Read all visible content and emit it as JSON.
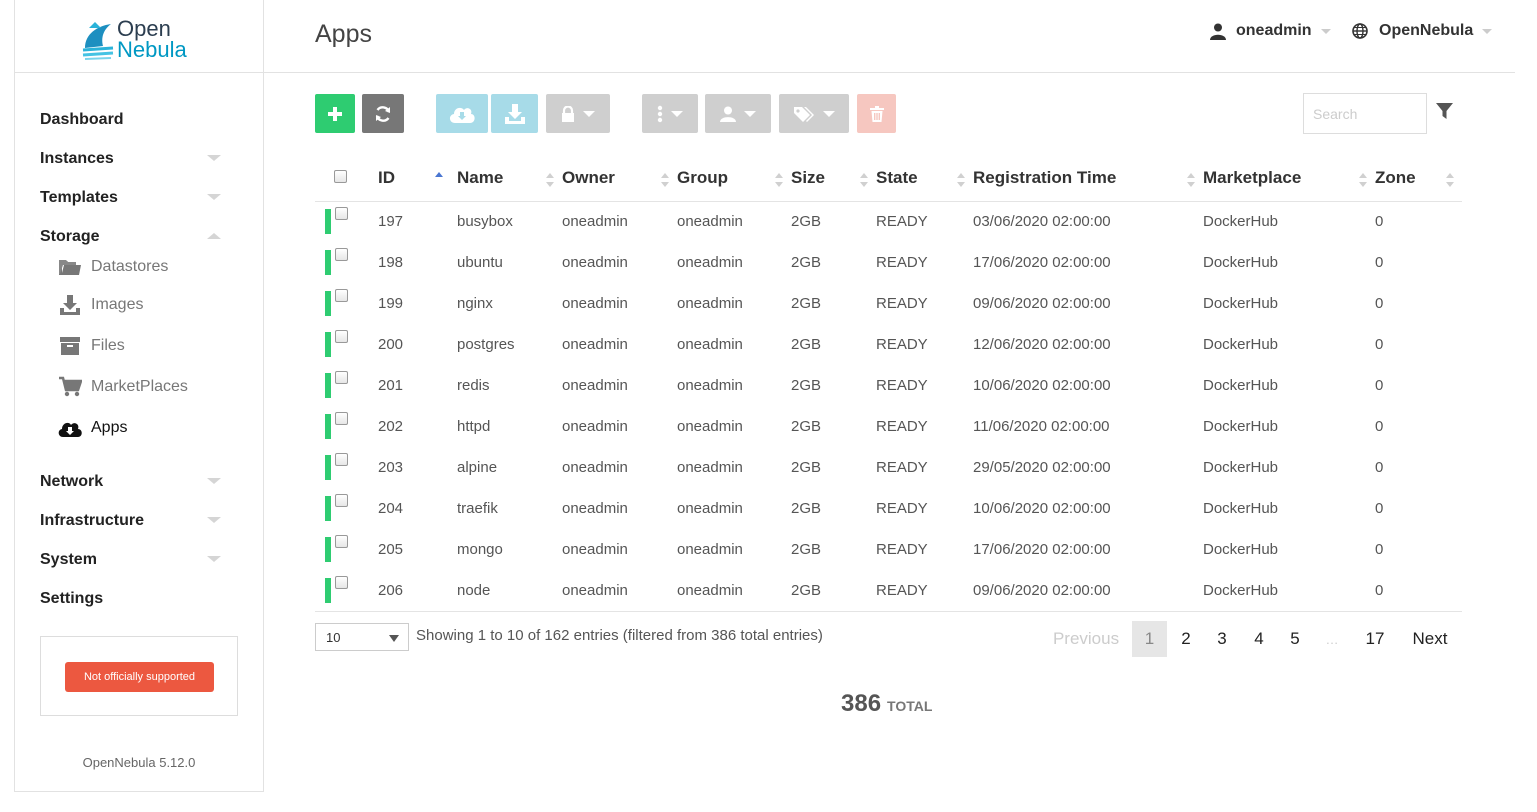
{
  "brand": {
    "line1": "Open",
    "line2": "Nebula"
  },
  "sidebar": {
    "items": [
      {
        "label": "Dashboard"
      },
      {
        "label": "Instances"
      },
      {
        "label": "Templates"
      },
      {
        "label": "Storage"
      },
      {
        "label": "Network"
      },
      {
        "label": "Infrastructure"
      },
      {
        "label": "System"
      },
      {
        "label": "Settings"
      }
    ],
    "storage_sub": [
      {
        "label": "Datastores",
        "icon": "folder-icon"
      },
      {
        "label": "Images",
        "icon": "download-icon"
      },
      {
        "label": "Files",
        "icon": "archive-icon"
      },
      {
        "label": "MarketPlaces",
        "icon": "cart-icon"
      },
      {
        "label": "Apps",
        "icon": "cloud-download-icon"
      }
    ],
    "support_badge": "Not officially supported",
    "version": "OpenNebula 5.12.0"
  },
  "header": {
    "title": "Apps",
    "user": "oneadmin",
    "zone": "OpenNebula"
  },
  "toolbar": {
    "search_placeholder": "Search",
    "colors": {
      "green": "#2ecc71",
      "gray": "#777777",
      "lightblue": "#a7dbe8",
      "lightgray": "#cfcfcf",
      "lightred": "#f6c7c0"
    }
  },
  "table": {
    "columns": [
      "ID",
      "Name",
      "Owner",
      "Group",
      "Size",
      "State",
      "Registration Time",
      "Marketplace",
      "Zone"
    ],
    "rows": [
      [
        "197",
        "busybox",
        "oneadmin",
        "oneadmin",
        "2GB",
        "READY",
        "03/06/2020 02:00:00",
        "DockerHub",
        "0"
      ],
      [
        "198",
        "ubuntu",
        "oneadmin",
        "oneadmin",
        "2GB",
        "READY",
        "17/06/2020 02:00:00",
        "DockerHub",
        "0"
      ],
      [
        "199",
        "nginx",
        "oneadmin",
        "oneadmin",
        "2GB",
        "READY",
        "09/06/2020 02:00:00",
        "DockerHub",
        "0"
      ],
      [
        "200",
        "postgres",
        "oneadmin",
        "oneadmin",
        "2GB",
        "READY",
        "12/06/2020 02:00:00",
        "DockerHub",
        "0"
      ],
      [
        "201",
        "redis",
        "oneadmin",
        "oneadmin",
        "2GB",
        "READY",
        "10/06/2020 02:00:00",
        "DockerHub",
        "0"
      ],
      [
        "202",
        "httpd",
        "oneadmin",
        "oneadmin",
        "2GB",
        "READY",
        "11/06/2020 02:00:00",
        "DockerHub",
        "0"
      ],
      [
        "203",
        "alpine",
        "oneadmin",
        "oneadmin",
        "2GB",
        "READY",
        "29/05/2020 02:00:00",
        "DockerHub",
        "0"
      ],
      [
        "204",
        "traefik",
        "oneadmin",
        "oneadmin",
        "2GB",
        "READY",
        "10/06/2020 02:00:00",
        "DockerHub",
        "0"
      ],
      [
        "205",
        "mongo",
        "oneadmin",
        "oneadmin",
        "2GB",
        "READY",
        "17/06/2020 02:00:00",
        "DockerHub",
        "0"
      ],
      [
        "206",
        "node",
        "oneadmin",
        "oneadmin",
        "2GB",
        "READY",
        "09/06/2020 02:00:00",
        "DockerHub",
        "0"
      ]
    ]
  },
  "footer": {
    "page_length": "10",
    "info": "Showing 1 to 10 of 162 entries (filtered from 386 total entries)",
    "pagination": [
      "Previous",
      "1",
      "2",
      "3",
      "4",
      "5",
      "…",
      "17",
      "Next"
    ],
    "total_count": "386",
    "total_label": "TOTAL"
  }
}
